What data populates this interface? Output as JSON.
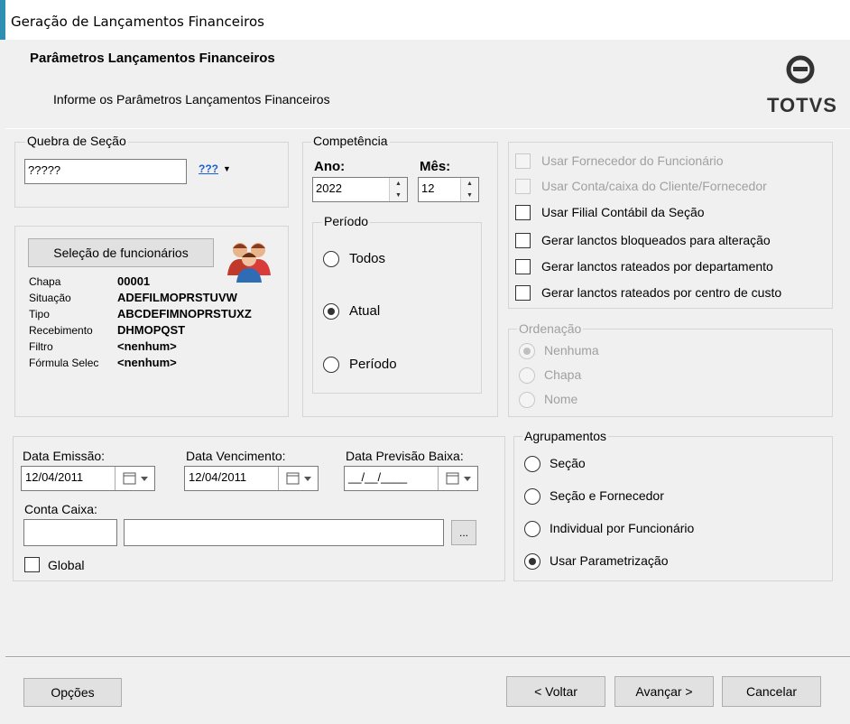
{
  "window": {
    "title": "Geração de Lançamentos Financeiros"
  },
  "header": {
    "title": "Parâmetros Lançamentos Financeiros",
    "subtitle": "Informe os Parâmetros Lançamentos Financeiros",
    "logo": "TOTVS"
  },
  "quebra": {
    "legend": "Quebra de Seção",
    "value": "?????",
    "lookup": "???"
  },
  "competencia": {
    "legend": "Competência",
    "ano_label": "Ano:",
    "ano": "2022",
    "mes_label": "Mês:",
    "mes": "12",
    "periodo_legend": "Período",
    "options": [
      "Todos",
      "Atual",
      "Período"
    ],
    "selected": "Atual"
  },
  "selecao": {
    "button": "Seleção de funcionários",
    "rows": [
      {
        "label": "Chapa",
        "value": "00001"
      },
      {
        "label": "Situação",
        "value": "ADEFILMOPRSTUVW"
      },
      {
        "label": "Tipo",
        "value": "ABCDEFIMNOPRSTUXZ"
      },
      {
        "label": "Recebimento",
        "value": "DHMOPQST"
      },
      {
        "label": "Filtro",
        "value": "<nenhum>"
      },
      {
        "label": "Fórmula Selec",
        "value": "<nenhum>"
      }
    ]
  },
  "options_checks": [
    {
      "label": "Usar Fornecedor do Funcionário",
      "enabled": false
    },
    {
      "label": "Usar Conta/caixa do Cliente/Fornecedor",
      "enabled": false
    },
    {
      "label": "Usar Filial Contábil da Seção",
      "enabled": true
    },
    {
      "label": "Gerar lanctos bloqueados para alteração",
      "enabled": true
    },
    {
      "label": "Gerar lanctos rateados por departamento",
      "enabled": true
    },
    {
      "label": "Gerar lanctos rateados por centro de custo",
      "enabled": true
    }
  ],
  "ordenacao": {
    "legend": "Ordenação",
    "options": [
      "Nenhuma",
      "Chapa",
      "Nome"
    ],
    "selected": "Nenhuma"
  },
  "datas": {
    "emissao_label": "Data Emissão:",
    "emissao": "12/04/2011",
    "vencimento_label": "Data Vencimento:",
    "vencimento": "12/04/2011",
    "previsao_label": "Data Previsão Baixa:",
    "previsao": "__/__/____",
    "conta_label": "Conta Caixa:",
    "conta_code": "",
    "conta_desc": "",
    "browse": "...",
    "global_label": "Global"
  },
  "agrupamentos": {
    "legend": "Agrupamentos",
    "options": [
      "Seção",
      "Seção e Fornecedor",
      "Individual por Funcionário",
      "Usar Parametrização"
    ],
    "selected": "Usar Parametrização"
  },
  "footer": {
    "opcoes": "Opções",
    "voltar": "< Voltar",
    "avancar": "Avançar >",
    "cancelar": "Cancelar"
  },
  "colors": {
    "accent": "#2f8fb3",
    "lookup": "#1a5fd6"
  }
}
